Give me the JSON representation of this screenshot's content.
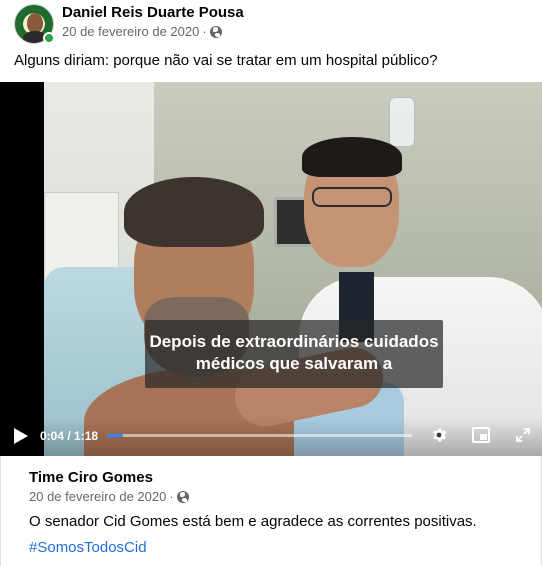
{
  "post": {
    "author": "Daniel Reis Duarte Pousa",
    "date": "20 de fevereiro de 2020",
    "separator": "·",
    "privacy_icon": "globe-icon",
    "text": "Alguns diriam: porque não vai se tratar em um hospital público?"
  },
  "video": {
    "subtitle_line1": "Depois de extraordinários cuidados",
    "subtitle_line2": "médicos que salvaram a",
    "time": "0:04 / 1:18",
    "progress": 0.0513,
    "icons": [
      "play-icon",
      "gear-icon",
      "picture-in-picture-icon",
      "fullscreen-icon"
    ]
  },
  "shared": {
    "author": "Time Ciro Gomes",
    "date": "20 de fevereiro de 2020",
    "separator": "·",
    "privacy_icon": "globe-icon",
    "text": "O senador Cid Gomes está bem e agradece as correntes positivas.",
    "hashtag": "#SomosTodosCid"
  },
  "colors": {
    "online": "#31a24c",
    "hashtag": "#216fdb",
    "progress": "#2d88ff",
    "meta": "#65676b"
  }
}
